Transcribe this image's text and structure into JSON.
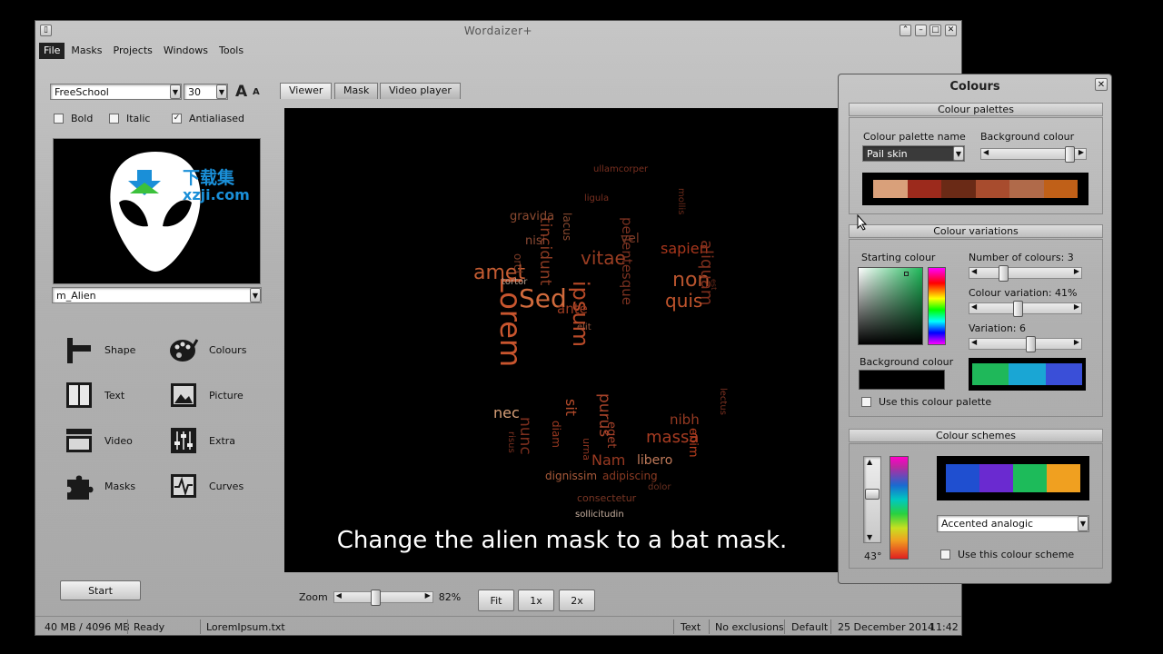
{
  "app": {
    "title": "Wordaizer+"
  },
  "menu": [
    "File",
    "Masks",
    "Projects",
    "Windows",
    "Tools"
  ],
  "font": {
    "family": "FreeSchool",
    "size": "30",
    "big_a": "A",
    "small_a": "A"
  },
  "options": {
    "bold": "Bold",
    "italic": "Italic",
    "antialiased": "Antialiased",
    "bold_checked": false,
    "italic_checked": false,
    "antialiased_checked": true
  },
  "mask": {
    "selected": "m_Alien"
  },
  "watermark": {
    "cn": "下载集",
    "url": "xzji.com"
  },
  "tools": {
    "shape": "Shape",
    "colours": "Colours",
    "text": "Text",
    "picture": "Picture",
    "video": "Video",
    "extra": "Extra",
    "masks": "Masks",
    "curves": "Curves"
  },
  "start_label": "Start",
  "tabs": [
    "Viewer",
    "Mask",
    "Video player"
  ],
  "viewer": {
    "caption": "Change the alien mask to a bat mask."
  },
  "zoom": {
    "label": "Zoom",
    "value": "82%",
    "level": 0.82,
    "fit": "Fit",
    "x1": "1x",
    "x2": "2x"
  },
  "status": {
    "memory": "40 MB / 4096 MB",
    "state": "Ready",
    "file": "LoremIpsum.txt",
    "mode": "Text",
    "exclusions": "No exclusions",
    "profile": "Default",
    "date": "25 December 2014",
    "time": "11:42"
  },
  "colours_panel": {
    "title": "Colours",
    "palettes_header": "Colour palettes",
    "palette_name_label": "Colour palette name",
    "palette_name": "Pail skin",
    "bg_colour_label": "Background colour",
    "palette_swatches": [
      "#d9a07a",
      "#9c2a1c",
      "#6a2a16",
      "#a84c2e",
      "#b06a4a",
      "#c06018"
    ],
    "variations_header": "Colour variations",
    "starting_colour": "Starting colour",
    "num_colours": "Number of colours: 3",
    "variation_label": "Colour variation: 41%",
    "variation_count": "Variation:  6",
    "background_colour": "Background colour",
    "variation_swatches": [
      "#1fb85a",
      "#1aa6d4",
      "#3a4fd8"
    ],
    "use_palette": "Use this colour palette",
    "schemes_header": "Colour schemes",
    "scheme_swatches": [
      "#1f4fd0",
      "#6a2ad0",
      "#1dbb5a",
      "#f0a020"
    ],
    "scheme_name": "Accented analogic",
    "angle": "43°",
    "use_scheme": "Use this colour scheme"
  },
  "colors": {
    "accent_red": "#b34a2a"
  },
  "wordcloud": [
    {
      "t": "Lorem",
      "c": "#c8552e"
    },
    {
      "t": "ipsum",
      "c": "#b84a28"
    },
    {
      "t": "Sed",
      "c": "#d06a3c"
    },
    {
      "t": "amet",
      "c": "#c45c32"
    },
    {
      "t": "non",
      "c": "#b8542e"
    },
    {
      "t": "quis",
      "c": "#c0542c"
    },
    {
      "t": "vitae",
      "c": "#9a3d22"
    },
    {
      "t": "sapien",
      "c": "#a8361c"
    },
    {
      "t": "tincidunt",
      "c": "#8a3a22"
    },
    {
      "t": "pellentesque",
      "c": "#7a3120"
    },
    {
      "t": "aliquam",
      "c": "#7d2e1c"
    },
    {
      "t": "gravida",
      "c": "#8c4a30"
    },
    {
      "t": "nec",
      "c": "#d8a078"
    },
    {
      "t": "purus",
      "c": "#a8432a"
    },
    {
      "t": "sit",
      "c": "#b24a2a"
    },
    {
      "t": "massa",
      "c": "#a83c22"
    },
    {
      "t": "nibh",
      "c": "#963a22"
    },
    {
      "t": "enim",
      "c": "#b43c1e"
    },
    {
      "t": "Nam",
      "c": "#9a3a22"
    },
    {
      "t": "libero",
      "c": "#c07a5a"
    },
    {
      "t": "nunc",
      "c": "#7d2f1e"
    },
    {
      "t": "dignissim",
      "c": "#a85a3a"
    },
    {
      "t": "adipiscing",
      "c": "#8a3a22"
    },
    {
      "t": "consectetur",
      "c": "#7a3624"
    },
    {
      "t": "sollicitudin",
      "c": "#c8b0a0"
    },
    {
      "t": "dolor",
      "c": "#6a3020"
    },
    {
      "t": "ante",
      "c": "#9c3a20"
    },
    {
      "t": "lacus",
      "c": "#8a4a30"
    },
    {
      "t": "orci",
      "c": "#7a3a26"
    },
    {
      "t": "nisi",
      "c": "#8c4a34"
    },
    {
      "t": "tortor",
      "c": "#b8a090"
    },
    {
      "t": "ullamcorper",
      "c": "#7a3020"
    },
    {
      "t": "vel",
      "c": "#7a3a26"
    },
    {
      "t": "eget",
      "c": "#a8422a"
    },
    {
      "t": "diam",
      "c": "#9c3a22"
    },
    {
      "t": "urna",
      "c": "#8a3420"
    },
    {
      "t": "risus",
      "c": "#7a3020"
    },
    {
      "t": "elit",
      "c": "#9a5a40"
    },
    {
      "t": "est",
      "c": "#6a2a1a"
    },
    {
      "t": "ligula",
      "c": "#7a3020"
    },
    {
      "t": "mollis",
      "c": "#6a2a1a"
    },
    {
      "t": "lectus",
      "c": "#7a3020"
    }
  ]
}
